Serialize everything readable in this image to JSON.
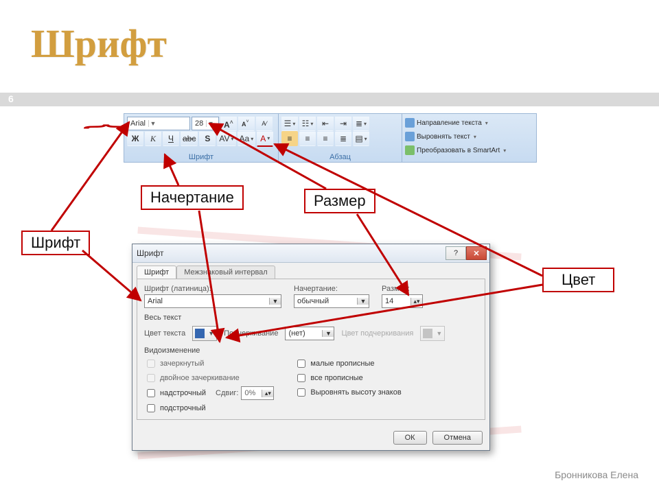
{
  "slide": {
    "title": "Шрифт",
    "number": "6",
    "author": "Бронникова Елена"
  },
  "annotations": {
    "nachertanie": "Начертание",
    "razmer": "Размер",
    "shrift": "Шрифт",
    "cvet": "Цвет"
  },
  "ribbon": {
    "font_name": "Arial",
    "font_size": "28",
    "bold": "Ж",
    "italic": "К",
    "underline": "Ч",
    "strike": "abc",
    "shadow": "S",
    "spacing": "AV",
    "case": "Aa",
    "fontcolor": "A",
    "group_font": "Шрифт",
    "group_para": "Абзац",
    "extra1": "Направление текста",
    "extra2": "Выровнять текст",
    "extra3": "Преобразовать в SmartArt"
  },
  "dialog": {
    "title": "Шрифт",
    "tab1": "Шрифт",
    "tab2": "Межзнаковый интервал",
    "lbl_font": "Шрифт (латиница):",
    "val_font": "Arial",
    "lbl_style": "Начертание:",
    "val_style": "обычный",
    "lbl_size": "Размер:",
    "val_size": "14",
    "sec_all": "Весь текст",
    "lbl_textcolor": "Цвет текста",
    "lbl_underline": "Подчеркивание",
    "val_underline": "(нет)",
    "lbl_ulinecolor": "Цвет подчеркивания",
    "sec_mod": "Видоизменение",
    "ck_strike": "зачеркнутый",
    "ck_dblstrike": "двойное зачеркивание",
    "ck_super": "надстрочный",
    "ck_sub": "подстрочный",
    "lbl_offset": "Сдвиг:",
    "val_offset": "0%",
    "ck_smallcaps": "малые прописные",
    "ck_allcaps": "все прописные",
    "ck_equalize": "Выровнять высоту знаков",
    "btn_ok": "ОК",
    "btn_cancel": "Отмена"
  }
}
